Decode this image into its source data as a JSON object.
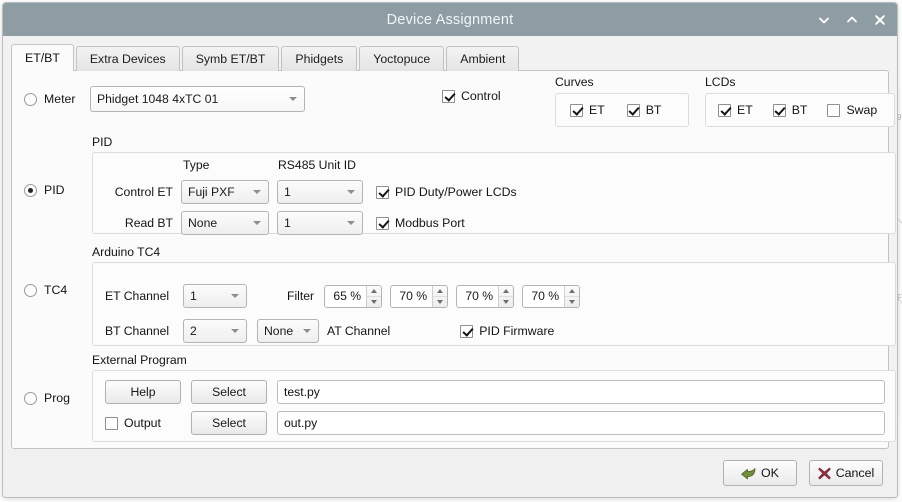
{
  "window": {
    "title": "Device Assignment",
    "controls": [
      {
        "name": "minimize",
        "glyph": "v"
      },
      {
        "name": "maximize",
        "glyph": "^"
      },
      {
        "name": "close",
        "glyph": "x"
      }
    ]
  },
  "tabs": [
    {
      "label": "ET/BT",
      "active": true
    },
    {
      "label": "Extra Devices",
      "active": false
    },
    {
      "label": "Symb ET/BT",
      "active": false
    },
    {
      "label": "Phidgets",
      "active": false
    },
    {
      "label": "Yoctopuce",
      "active": false
    },
    {
      "label": "Ambient",
      "active": false
    }
  ],
  "meter": {
    "radio_label": "Meter",
    "radio_selected": false,
    "device": "Phidget 1048 4xTC 01"
  },
  "control": {
    "label": "Control",
    "checked": true
  },
  "curves": {
    "title": "Curves",
    "et_label": "ET",
    "et_checked": true,
    "bt_label": "BT",
    "bt_checked": true
  },
  "lcds": {
    "title": "LCDs",
    "et_label": "ET",
    "et_checked": true,
    "bt_label": "BT",
    "bt_checked": true,
    "swap_label": "Swap",
    "swap_checked": false
  },
  "pid": {
    "group_title": "PID",
    "radio_label": "PID",
    "radio_selected": true,
    "col_type": "Type",
    "col_unit_id": "RS485 Unit ID",
    "rows": [
      {
        "label": "Control ET",
        "type": "Fuji PXF",
        "unit_id": "1",
        "check_label": "PID Duty/Power LCDs",
        "checked": true
      },
      {
        "label": "Read BT",
        "type": "None",
        "unit_id": "1",
        "check_label": "Modbus Port",
        "checked": true
      }
    ]
  },
  "tc4": {
    "group_title": "Arduino TC4",
    "radio_label": "TC4",
    "radio_selected": false,
    "et_channel_label": "ET Channel",
    "et_channel": "1",
    "bt_channel_label": "BT Channel",
    "bt_channel": "2",
    "at_channel_value": "None",
    "at_channel_label": "AT Channel",
    "filter_label": "Filter",
    "filters": [
      "65 %",
      "70 %",
      "70 %",
      "70 %"
    ],
    "pid_firmware_label": "PID Firmware",
    "pid_firmware_checked": true
  },
  "external_program": {
    "group_title": "External Program",
    "radio_label": "Prog",
    "radio_selected": false,
    "help_label": "Help",
    "select_label_1": "Select",
    "path_1": "test.py",
    "output_label": "Output",
    "output_checked": false,
    "select_label_2": "Select",
    "path_2": "out.py"
  },
  "dialog_buttons": {
    "ok": "OK",
    "cancel": "Cancel"
  },
  "colors": {
    "titlebar": "#8e9ca4",
    "titlebar_text": "#f2f5f6",
    "dialog_bg": "#f2f2f2",
    "page_bg": "#fbfbfb",
    "ok_icon": "#6a8a3a",
    "cancel_icon": "#8f3142"
  }
}
